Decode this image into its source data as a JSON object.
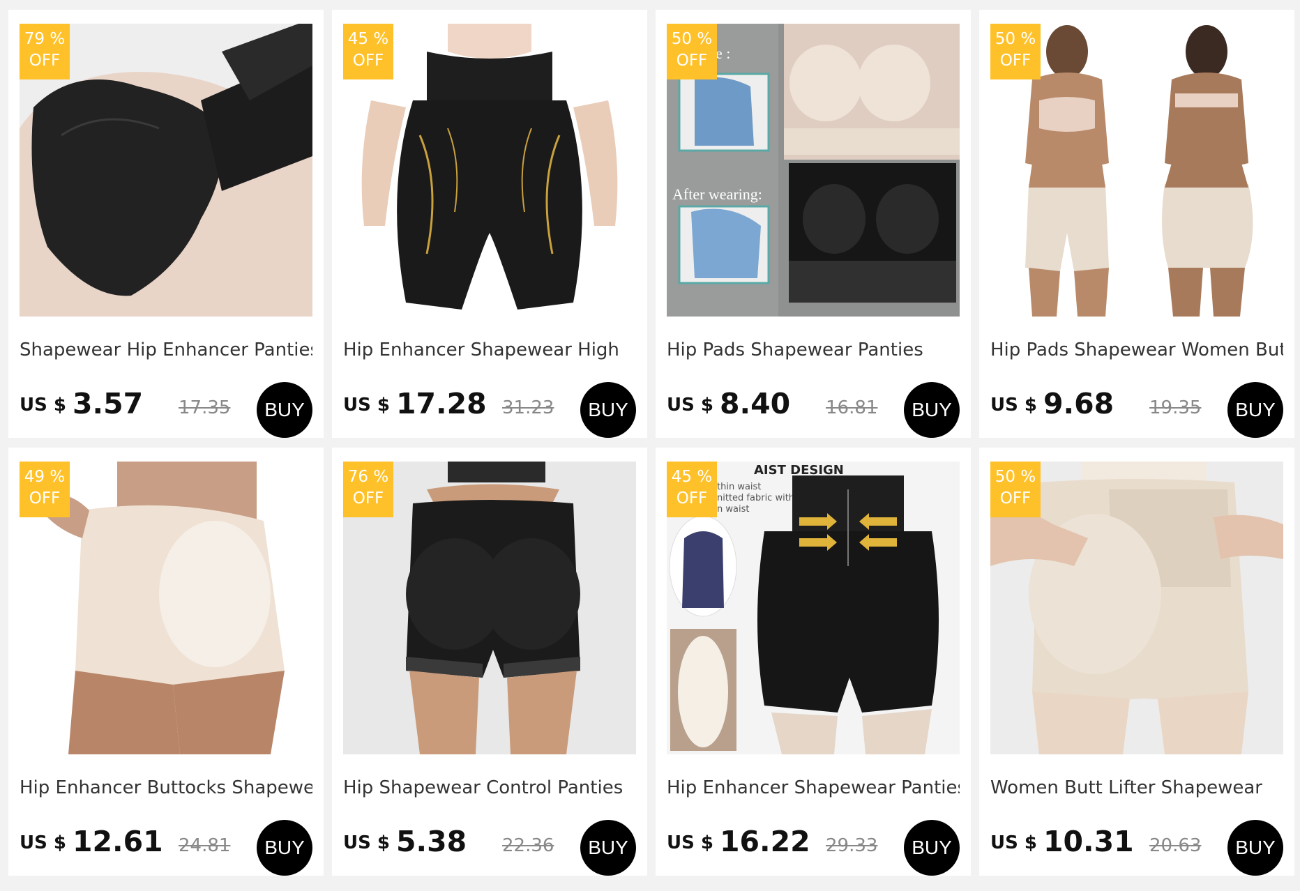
{
  "products": [
    {
      "discount_pct": "79 %",
      "discount_off": "OFF",
      "title": "Shapewear Hip Enhancer Panties",
      "currency": "US $",
      "price": "3.57",
      "original_price": "17.35",
      "buy_label": "BUY"
    },
    {
      "discount_pct": "45 %",
      "discount_off": "OFF",
      "title": "Hip Enhancer Shapewear High",
      "currency": "US $",
      "price": "17.28",
      "original_price": "31.23",
      "buy_label": "BUY"
    },
    {
      "discount_pct": "50 %",
      "discount_off": "OFF",
      "title": "Hip Pads Shapewear Panties",
      "currency": "US $",
      "price": "8.40",
      "original_price": "16.81",
      "buy_label": "BUY",
      "image_text": {
        "top": "e :",
        "after": "After wearing:"
      }
    },
    {
      "discount_pct": "50 %",
      "discount_off": "OFF",
      "title": "Hip Pads Shapewear Women Butt",
      "currency": "US $",
      "price": "9.68",
      "original_price": "19.35",
      "buy_label": "BUY"
    },
    {
      "discount_pct": "49 %",
      "discount_off": "OFF",
      "title": "Hip Enhancer Buttocks Shapewear",
      "currency": "US $",
      "price": "12.61",
      "original_price": "24.81",
      "buy_label": "BUY"
    },
    {
      "discount_pct": "76 %",
      "discount_off": "OFF",
      "title": "Hip Shapewear Control Panties",
      "currency": "US $",
      "price": "5.38",
      "original_price": "22.36",
      "buy_label": "BUY"
    },
    {
      "discount_pct": "45 %",
      "discount_off": "OFF",
      "title": "Hip Enhancer Shapewear Panties",
      "currency": "US $",
      "price": "16.22",
      "original_price": "29.33",
      "buy_label": "BUY",
      "image_text": {
        "heading": "AIST DESIGN",
        "line1": "thin waist",
        "line2": "nitted fabric with",
        "line3": "n waist"
      }
    },
    {
      "discount_pct": "50 %",
      "discount_off": "OFF",
      "title": "Women Butt Lifter Shapewear",
      "currency": "US $",
      "price": "10.31",
      "original_price": "20.63",
      "buy_label": "BUY"
    }
  ],
  "colors": {
    "badge": "#ffc12a",
    "buy_button": "#000000",
    "page_bg": "#f2f2f2"
  }
}
